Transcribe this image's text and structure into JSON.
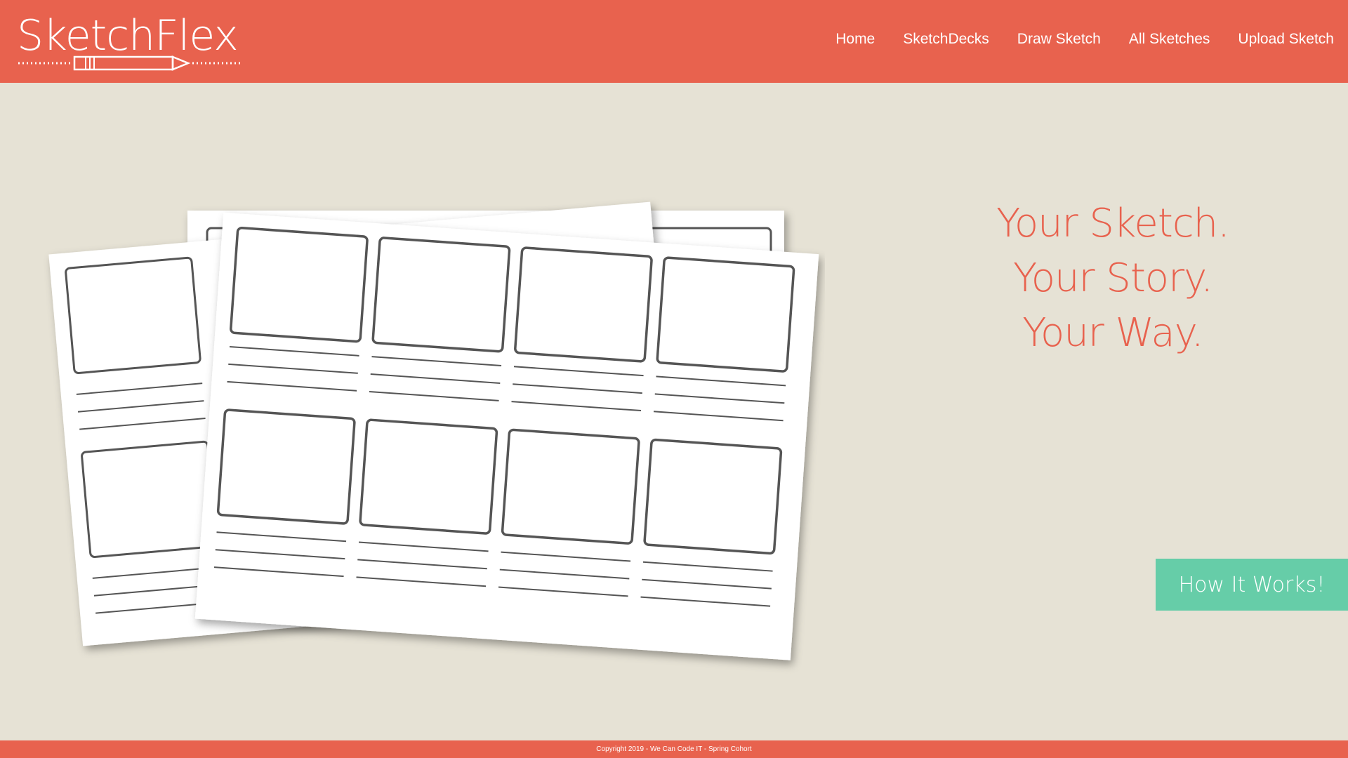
{
  "header": {
    "logo_text": "SketchFlex",
    "nav": [
      "Home",
      "SketchDecks",
      "Draw Sketch",
      "All Sketches",
      "Upload Sketch"
    ]
  },
  "hero": {
    "tagline": [
      "Your Sketch.",
      "Your Story.",
      "Your Way."
    ],
    "cta_label": "How It Works!"
  },
  "footer": {
    "copyright": "Copyright 2019 - We Can Code IT - Spring Cohort"
  },
  "colors": {
    "brand": "#e8624e",
    "background": "#e6e2d5",
    "accent": "#66cda8"
  }
}
